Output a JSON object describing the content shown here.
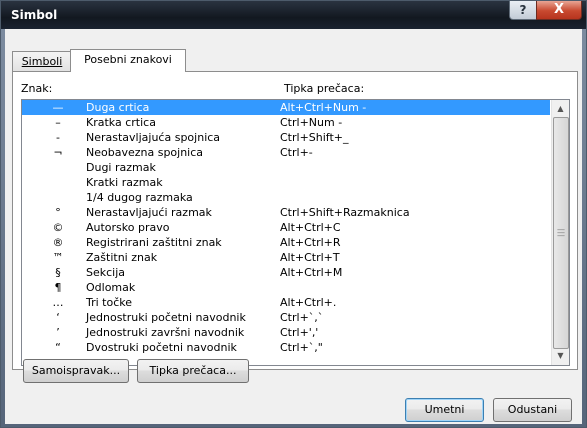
{
  "window": {
    "title": "Simbol",
    "help_label": "?",
    "close_label": "X"
  },
  "tabs": [
    {
      "label": "Simboli"
    },
    {
      "label": "Posebni znakovi"
    }
  ],
  "list": {
    "headers": {
      "char": "Znak:",
      "shortcut": "Tipka prečaca:"
    },
    "rows": [
      {
        "char": "—",
        "name": "Duga crtica",
        "shortcut": "Alt+Ctrl+Num -"
      },
      {
        "char": "–",
        "name": "Kratka crtica",
        "shortcut": "Ctrl+Num -"
      },
      {
        "char": "-",
        "name": "Nerastavljajuća spojnica",
        "shortcut": "Ctrl+Shift+_"
      },
      {
        "char": "¬",
        "name": "Neobavezna spojnica",
        "shortcut": "Ctrl+-"
      },
      {
        "char": "",
        "name": "Dugi razmak",
        "shortcut": ""
      },
      {
        "char": "",
        "name": "Kratki razmak",
        "shortcut": ""
      },
      {
        "char": "",
        "name": "1/4 dugog razmaka",
        "shortcut": ""
      },
      {
        "char": "°",
        "name": "Nerastavljajući razmak",
        "shortcut": "Ctrl+Shift+Razmaknica"
      },
      {
        "char": "©",
        "name": "Autorsko pravo",
        "shortcut": "Alt+Ctrl+C"
      },
      {
        "char": "®",
        "name": "Registrirani zaštitni znak",
        "shortcut": "Alt+Ctrl+R"
      },
      {
        "char": "™",
        "name": "Zaštitni znak",
        "shortcut": "Alt+Ctrl+T"
      },
      {
        "char": "§",
        "name": "Sekcija",
        "shortcut": "Alt+Ctrl+M"
      },
      {
        "char": "¶",
        "name": "Odlomak",
        "shortcut": ""
      },
      {
        "char": "…",
        "name": "Tri točke",
        "shortcut": "Alt+Ctrl+."
      },
      {
        "char": "‘",
        "name": "Jednostruki početni navodnik",
        "shortcut": "Ctrl+`,`"
      },
      {
        "char": "’",
        "name": "Jednostruki završni navodnik",
        "shortcut": "Ctrl+',' "
      },
      {
        "char": "“",
        "name": "Dvostruki početni navodnik",
        "shortcut": "Ctrl+`,\""
      }
    ],
    "selected_index": 0
  },
  "buttons": {
    "autocorrect": "Samoispravak...",
    "shortcut_key": "Tipka prečaca...",
    "insert": "Umetni",
    "cancel": "Odustani"
  },
  "colors": {
    "selection": "#3399ff",
    "close": "#c8492f"
  }
}
